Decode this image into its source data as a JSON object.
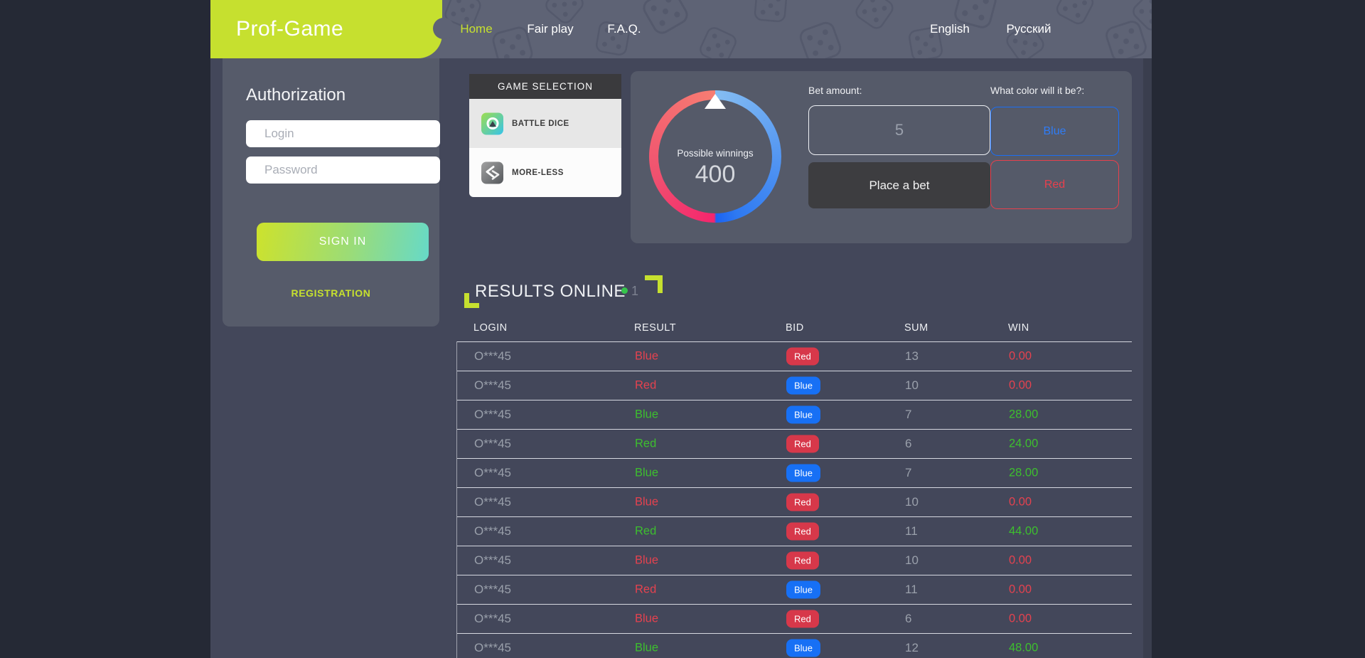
{
  "header": {
    "logo": "Prof-Game",
    "nav": [
      {
        "label": "Home",
        "active": true
      },
      {
        "label": "Fair play",
        "active": false
      },
      {
        "label": "F.A.Q.",
        "active": false
      }
    ],
    "languages": [
      {
        "label": "English"
      },
      {
        "label": "Русский"
      }
    ]
  },
  "auth": {
    "title": "Authorization",
    "login_placeholder": "Login",
    "password_placeholder": "Password",
    "sign_in_label": "SIGN IN",
    "registration_label": "REGISTRATION"
  },
  "game_selection": {
    "title": "GAME SELECTION",
    "items": [
      {
        "label": "BATTLE DICE",
        "selected": true,
        "icon": "battle-dice-icon"
      },
      {
        "label": "MORE-LESS",
        "selected": false,
        "icon": "more-less-icon"
      }
    ]
  },
  "bet_panel": {
    "gauge": {
      "label": "Possible winnings",
      "value": "400",
      "red_color": "#f5256d",
      "blue_color": "#1b63f2",
      "pointer": "white-triangle-up"
    },
    "bet_amount_label": "Bet amount:",
    "bet_amount_value": "5",
    "place_bet_label": "Place a bet",
    "color_question": "What color will it be?:",
    "color_options": [
      {
        "label": "Blue",
        "color": "#1a6ef5"
      },
      {
        "label": "Red",
        "color": "#e8404d"
      }
    ]
  },
  "results": {
    "title": "RESULTS ONLINE",
    "online_count": "1",
    "online_dot_color": "#35c44b",
    "columns": [
      "LOGIN",
      "RESULT",
      "BID",
      "SUM",
      "WIN"
    ],
    "rows": [
      {
        "login": "O***45",
        "result": "Blue",
        "outcome": "loss",
        "bid": "Red",
        "sum": "13",
        "win": "0.00"
      },
      {
        "login": "O***45",
        "result": "Red",
        "outcome": "loss",
        "bid": "Blue",
        "sum": "10",
        "win": "0.00"
      },
      {
        "login": "O***45",
        "result": "Blue",
        "outcome": "win",
        "bid": "Blue",
        "sum": "7",
        "win": "28.00"
      },
      {
        "login": "O***45",
        "result": "Red",
        "outcome": "win",
        "bid": "Red",
        "sum": "6",
        "win": "24.00"
      },
      {
        "login": "O***45",
        "result": "Blue",
        "outcome": "win",
        "bid": "Blue",
        "sum": "7",
        "win": "28.00"
      },
      {
        "login": "O***45",
        "result": "Blue",
        "outcome": "loss",
        "bid": "Red",
        "sum": "10",
        "win": "0.00"
      },
      {
        "login": "O***45",
        "result": "Red",
        "outcome": "win",
        "bid": "Red",
        "sum": "11",
        "win": "44.00"
      },
      {
        "login": "O***45",
        "result": "Blue",
        "outcome": "loss",
        "bid": "Red",
        "sum": "10",
        "win": "0.00"
      },
      {
        "login": "O***45",
        "result": "Red",
        "outcome": "loss",
        "bid": "Blue",
        "sum": "11",
        "win": "0.00"
      },
      {
        "login": "O***45",
        "result": "Blue",
        "outcome": "loss",
        "bid": "Red",
        "sum": "6",
        "win": "0.00"
      },
      {
        "login": "O***45",
        "result": "Blue",
        "outcome": "win",
        "bid": "Blue",
        "sum": "12",
        "win": "48.00"
      }
    ]
  },
  "colors": {
    "page_background": "#252935",
    "content_background": "#43475a",
    "header_background": "#5e6375",
    "panel_background": "#555a69",
    "accent_lime": "#c6e02f",
    "badge_red": "#d7384a",
    "badge_blue": "#1770f5",
    "win_green": "#3dbf2e",
    "loss_red": "#e4424f"
  }
}
